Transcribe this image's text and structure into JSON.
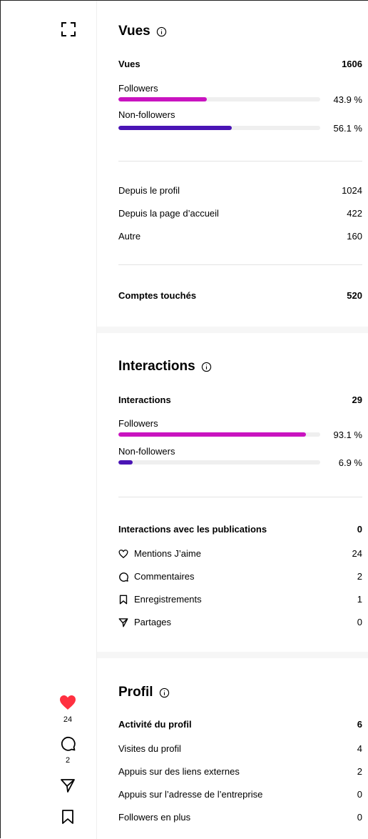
{
  "colors": {
    "followers": "#c913c0",
    "non_followers": "#4a14b5",
    "heart": "#ff3040"
  },
  "rail": {
    "likes": "24",
    "comments": "2"
  },
  "views": {
    "title": "Vues",
    "total_label": "Vues",
    "total_value": "1606",
    "followers_label": "Followers",
    "followers_pct": "43.9 %",
    "followers_fraction": 0.439,
    "nonfollowers_label": "Non-followers",
    "nonfollowers_pct": "56.1 %",
    "nonfollowers_fraction": 0.561,
    "sources": [
      {
        "label": "Depuis le profil",
        "value": "1024"
      },
      {
        "label": "Depuis la page d’accueil",
        "value": "422"
      },
      {
        "label": "Autre",
        "value": "160"
      }
    ],
    "reached_label": "Comptes touchés",
    "reached_value": "520"
  },
  "interactions": {
    "title": "Interactions",
    "total_label": "Interactions",
    "total_value": "29",
    "followers_label": "Followers",
    "followers_pct": "93.1 %",
    "followers_fraction": 0.931,
    "nonfollowers_label": "Non-followers",
    "nonfollowers_pct": "6.9 %",
    "nonfollowers_fraction": 0.069,
    "posts_label": "Interactions avec les publications",
    "posts_value": "0",
    "items": [
      {
        "icon": "heart-outline-icon",
        "label": "Mentions J’aime",
        "value": "24"
      },
      {
        "icon": "comment-icon",
        "label": "Commentaires",
        "value": "2"
      },
      {
        "icon": "bookmark-icon",
        "label": "Enregistrements",
        "value": "1"
      },
      {
        "icon": "share-icon",
        "label": "Partages",
        "value": "0"
      }
    ]
  },
  "profile": {
    "title": "Profil",
    "activity_label": "Activité du profil",
    "activity_value": "6",
    "items": [
      {
        "label": "Visites du profil",
        "value": "4"
      },
      {
        "label": "Appuis sur des liens externes",
        "value": "2"
      },
      {
        "label": "Appuis sur l’adresse de l’entreprise",
        "value": "0"
      },
      {
        "label": "Followers en plus",
        "value": "0"
      }
    ]
  }
}
